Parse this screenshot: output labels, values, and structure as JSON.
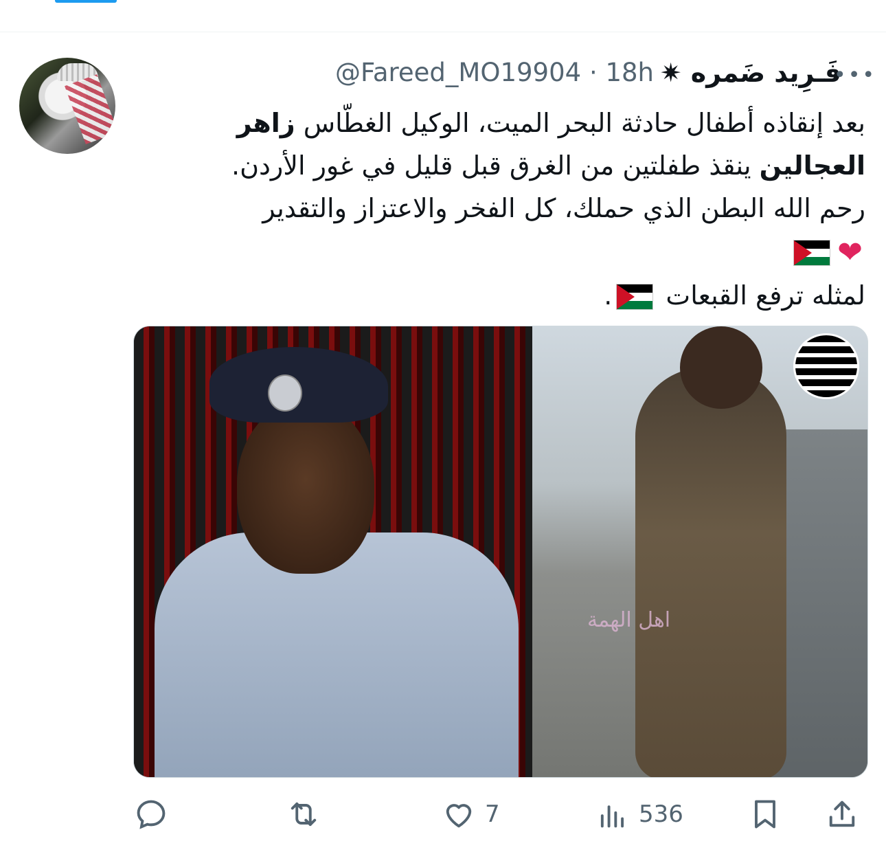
{
  "tweet": {
    "author_name": "فَـرِيد ضَمره ✷",
    "handle": "@Fareed_MO19904",
    "time": "18h",
    "text_line1_prefix": "بعد إنقاذه أطفال حادثة البحر الميت، الوكيل الغطّاس ",
    "text_line1_bold": "زاهر",
    "text_line2_bold": "العجالين",
    "text_line2_rest": " ينقذ طفلتين من الغرق قبل قليل في غور الأردن.",
    "text_line3": "رحم الله البطن الذي حملك، كل الفخر والاعتزاز والتقدير",
    "text_line5": "لمثله ترفع القبعات",
    "text_line5_end": ".",
    "watermark": "اهل الهمة"
  },
  "actions": {
    "reply_count": "",
    "retweet_count": "",
    "like_count": "7",
    "views_count": "536"
  },
  "colors": {
    "text": "#0f1419",
    "secondary": "#536471",
    "accent": "#1d9bf0",
    "heart": "#e0245e"
  },
  "icons": [
    "reply-icon",
    "retweet-icon",
    "like-icon",
    "views-icon",
    "bookmark-icon",
    "share-icon",
    "more-icon",
    "jordan-flag-icon",
    "red-heart-icon"
  ]
}
